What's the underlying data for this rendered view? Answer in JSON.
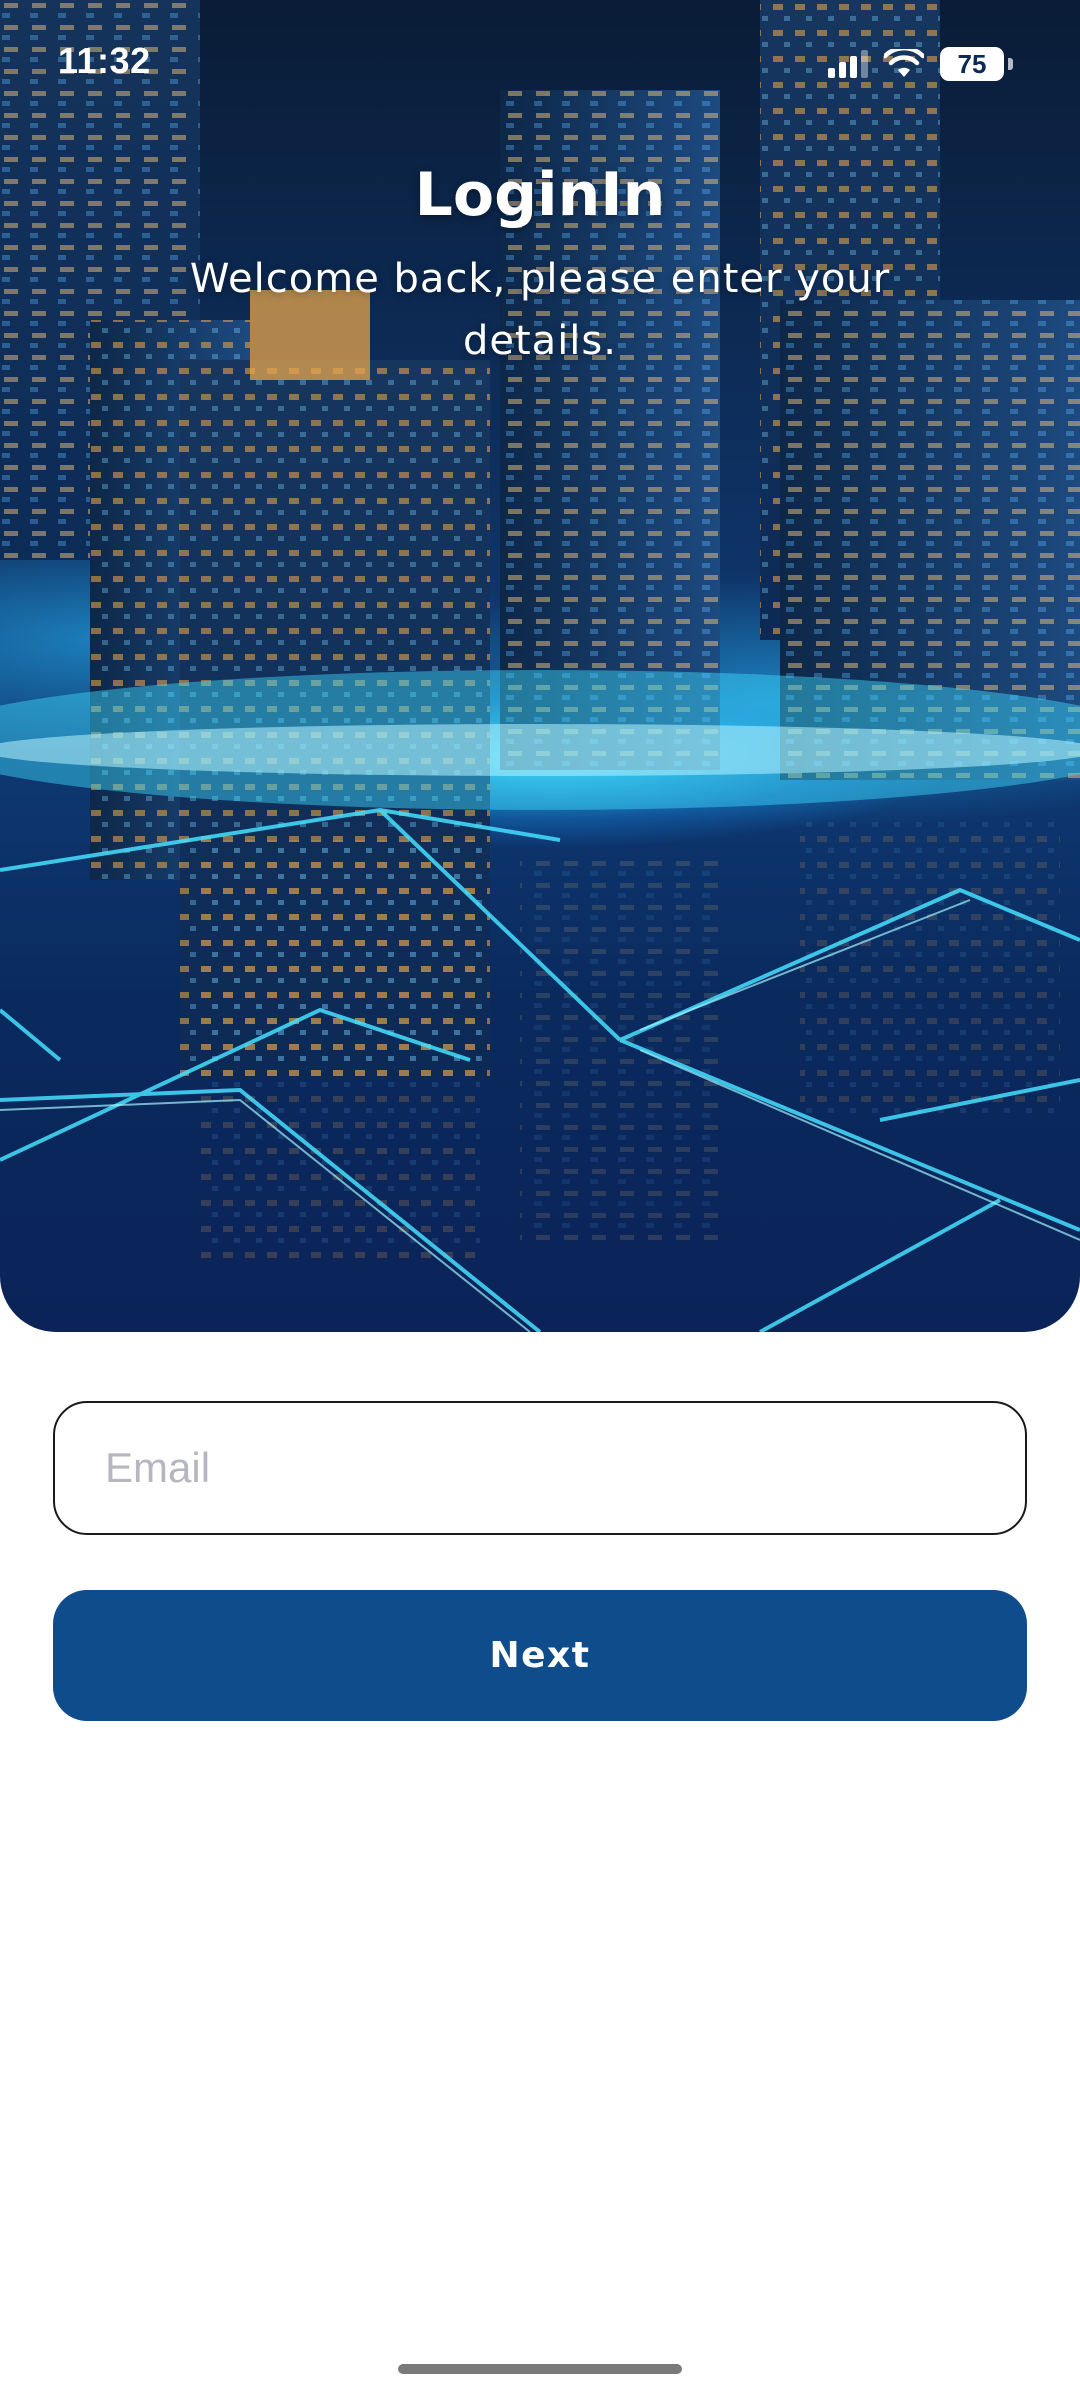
{
  "status_bar": {
    "time": "11:32",
    "battery_level": "75",
    "signal_icon": "cellular-signal-icon",
    "wifi_icon": "wifi-icon"
  },
  "header": {
    "title": "LoginIn",
    "subtitle": "Welcome back, please enter your details."
  },
  "form": {
    "email_value": "",
    "email_placeholder": "Email",
    "next_label": "Next"
  },
  "colors": {
    "primary_button": "#0f4c8c",
    "input_border": "#1a1a1a",
    "placeholder": "#b6b6c0"
  }
}
